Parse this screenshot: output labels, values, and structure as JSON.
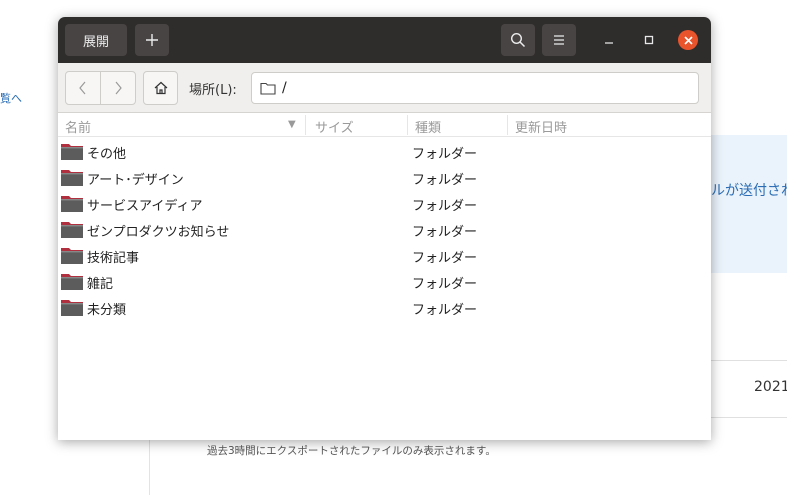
{
  "background": {
    "sidebar_link": "覧へ",
    "banner_text": "ルが送付され",
    "year": "2021",
    "footnote": "過去3時間にエクスポートされたファイルのみ表示されます。"
  },
  "dialog": {
    "header": {
      "expand_label": "展開",
      "add_icon": "plus-icon",
      "search_icon": "search-icon",
      "menu_icon": "hamburger-menu-icon",
      "minimize_icon": "minimize-icon",
      "maximize_icon": "maximize-icon",
      "close_icon": "close-icon",
      "close_color": "#e9542c"
    },
    "location": {
      "label": "場所(L):",
      "path": "/",
      "back_icon": "chevron-left-icon",
      "forward_icon": "chevron-right-icon",
      "home_icon": "home-icon"
    },
    "columns": {
      "name": "名前",
      "size": "サイズ",
      "type": "種類",
      "modified": "更新日時"
    },
    "files": [
      {
        "name": "その他",
        "type": "フォルダー"
      },
      {
        "name": "アート･デザイン",
        "type": "フォルダー"
      },
      {
        "name": "サービスアイディア",
        "type": "フォルダー"
      },
      {
        "name": "ゼンプロダクツお知らせ",
        "type": "フォルダー"
      },
      {
        "name": "技術記事",
        "type": "フォルダー"
      },
      {
        "name": "雑記",
        "type": "フォルダー"
      },
      {
        "name": "未分類",
        "type": "フォルダー"
      }
    ],
    "folder_color": "#b0303f"
  }
}
